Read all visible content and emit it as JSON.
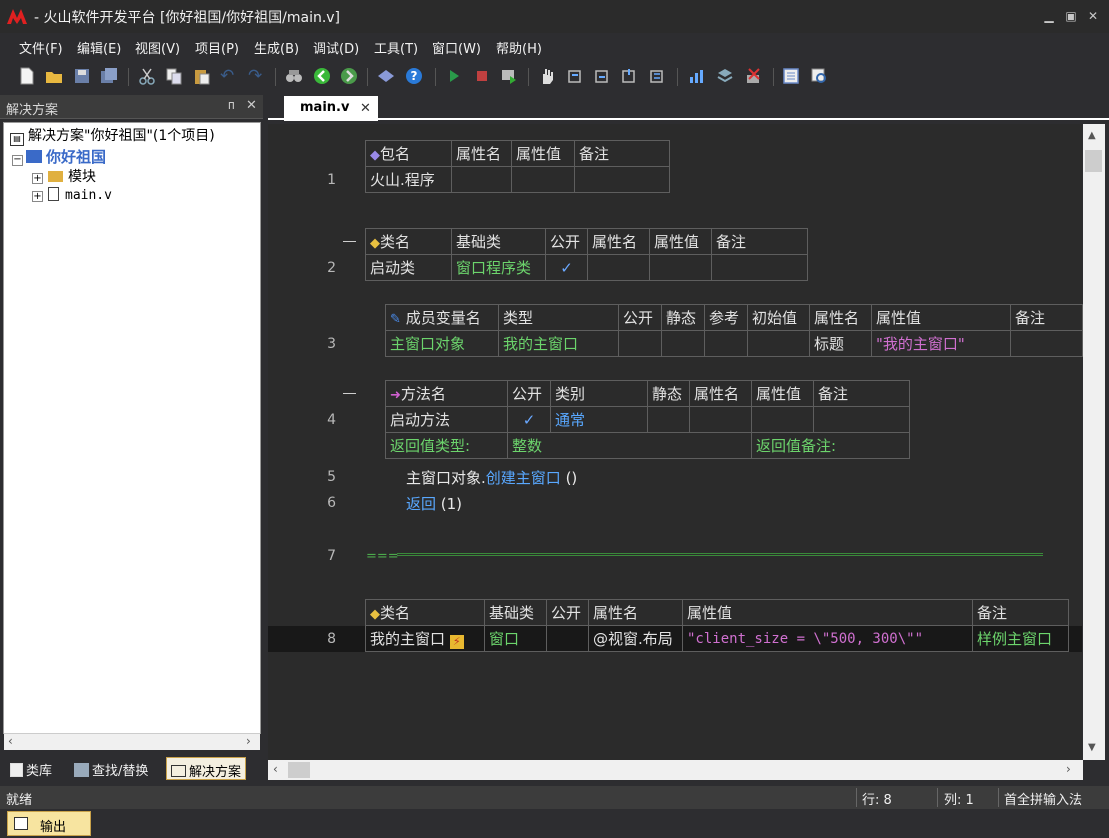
{
  "window": {
    "title": "- 火山软件开发平台 [你好祖国/你好祖国/main.v]"
  },
  "menu": [
    "文件(F)",
    "编辑(E)",
    "视图(V)",
    "项目(P)",
    "生成(B)",
    "调试(D)",
    "工具(T)",
    "窗口(W)",
    "帮助(H)"
  ],
  "toolbar": {
    "icons": [
      "new-file-icon",
      "open-folder-icon",
      "save-icon",
      "save-all-icon",
      "cut-icon",
      "copy-icon",
      "paste-icon",
      "undo-icon",
      "redo-icon",
      "find-icon",
      "back-icon",
      "forward-icon",
      "help-book-icon",
      "help-icon",
      "run-icon",
      "stop-icon",
      "debug-icon",
      "hand-icon",
      "step-into-icon",
      "step-over-icon",
      "step-out-icon",
      "step-icon",
      "chart-icon",
      "stack-icon",
      "clear-icon",
      "panel-icon",
      "inspect-icon"
    ]
  },
  "solution_panel": {
    "title": "解决方案",
    "pin": "ᴨ",
    "close": "✕",
    "tree": {
      "root": "解决方案\"你好祖国\"(1个项目)",
      "project": "你好祖国",
      "items": [
        "模块",
        "main.v"
      ]
    },
    "tabs": [
      "类库",
      "查找/替换",
      "解决方案"
    ]
  },
  "editor": {
    "tab": "main.v",
    "lines": [
      "1",
      "2",
      "3",
      "4",
      "5",
      "6",
      "7",
      "8"
    ],
    "package_table": {
      "headers": [
        "包名",
        "属性名",
        "属性值",
        "备注"
      ],
      "row": [
        "火山.程序",
        "",
        "",
        ""
      ]
    },
    "class_table": {
      "headers": [
        "类名",
        "基础类",
        "公开",
        "属性名",
        "属性值",
        "备注"
      ],
      "row": [
        "启动类",
        "窗口程序类",
        "✓",
        "",
        "",
        ""
      ]
    },
    "member_table": {
      "headers": [
        "成员变量名",
        "类型",
        "公开",
        "静态",
        "参考",
        "初始值",
        "属性名",
        "属性值",
        "备注"
      ],
      "row": [
        "主窗口对象",
        "我的主窗口",
        "",
        "",
        "",
        "",
        "标题",
        "\"我的主窗口\"",
        ""
      ]
    },
    "method_table": {
      "headers": [
        "方法名",
        "公开",
        "类别",
        "静态",
        "属性名",
        "属性值",
        "备注"
      ],
      "row": [
        "启动方法",
        "✓",
        "通常",
        "",
        "",
        "",
        ""
      ],
      "ret_label": "返回值类型:",
      "ret_type": "整数",
      "ret_note_label": "返回值备注:"
    },
    "code": {
      "line5_obj": "主窗口对象.",
      "line5_call": "创建主窗口",
      "line5_args": " ()",
      "line6_kw": "返回",
      "line6_args": " (1)",
      "separator": "==="
    },
    "class2_table": {
      "headers": [
        "类名",
        "基础类",
        "公开",
        "属性名",
        "属性值",
        "备注"
      ],
      "row": [
        "我的主窗口",
        "窗口",
        "",
        "@视窗.布局",
        "\"client_size = \\\"500, 300\\\"\"",
        "样例主窗口"
      ]
    }
  },
  "statusbar": {
    "status": "就绪",
    "row": "行: 8",
    "col": "列: 1",
    "ime": "首全拼输入法"
  },
  "output_button": "输出"
}
